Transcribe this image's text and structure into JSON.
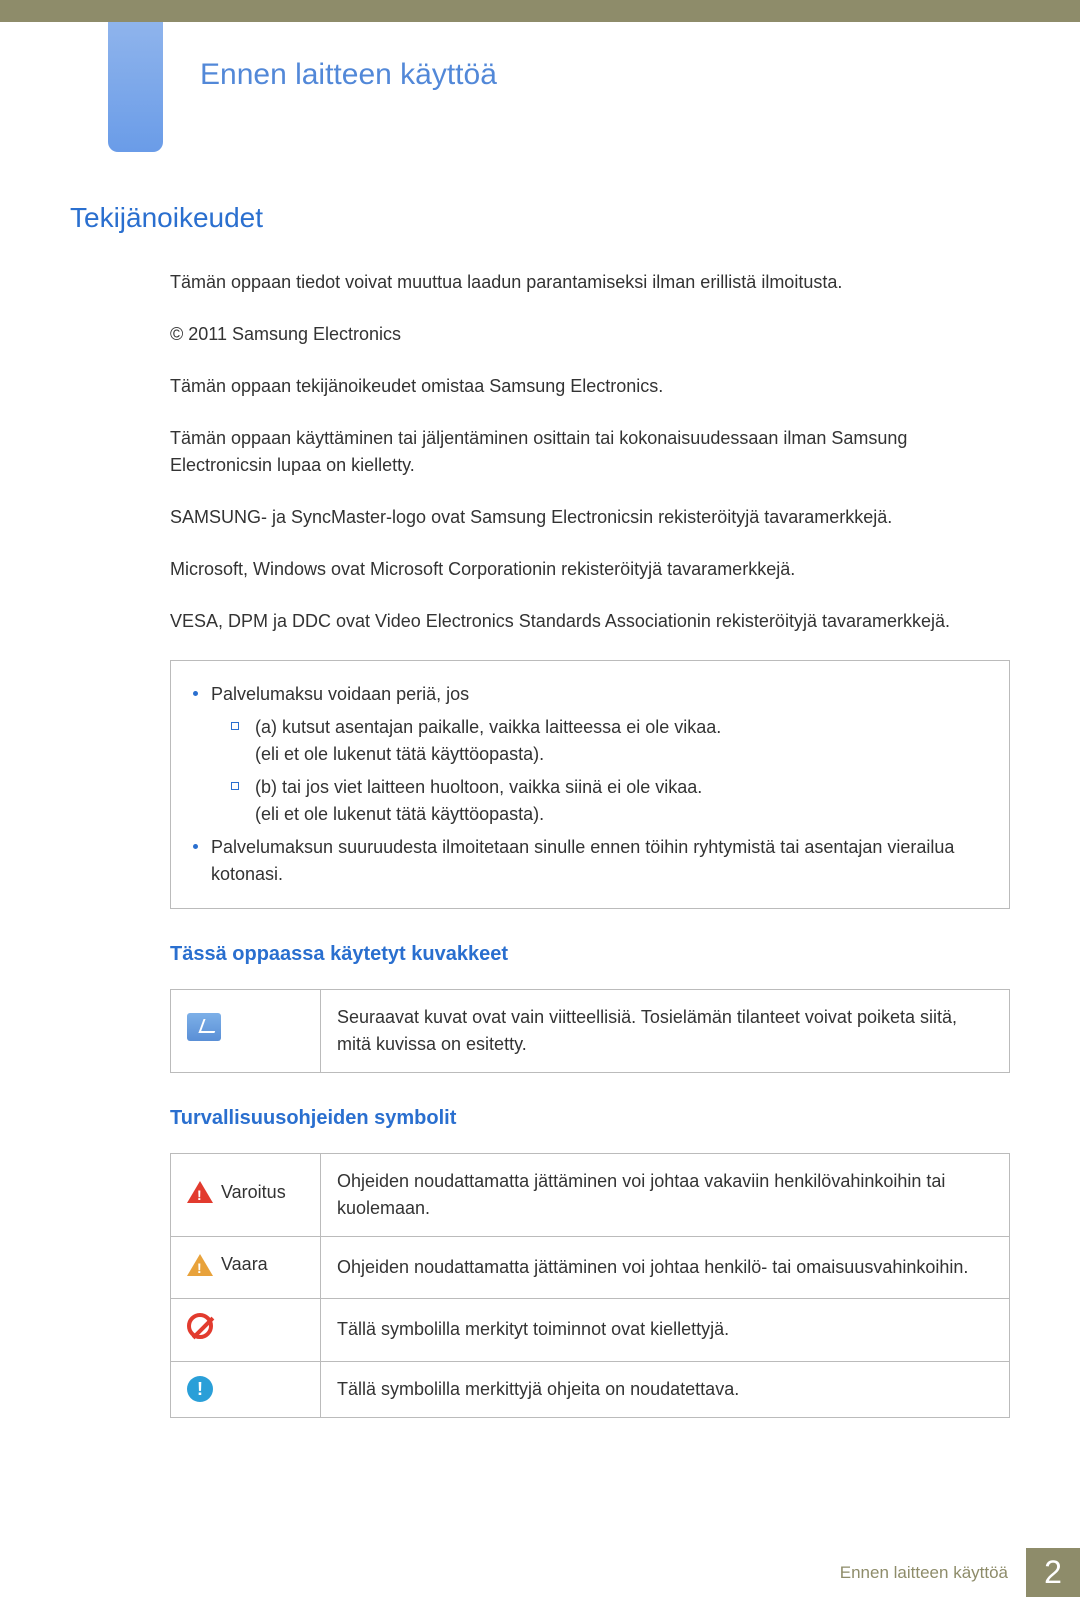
{
  "header": {
    "chapter_title": "Ennen laitteen käyttöä"
  },
  "section": {
    "title": "Tekijänoikeudet",
    "paragraphs": [
      "Tämän oppaan tiedot voivat muuttua laadun parantamiseksi ilman erillistä ilmoitusta.",
      "© 2011 Samsung Electronics",
      "Tämän oppaan tekijänoikeudet omistaa Samsung Electronics.",
      "Tämän oppaan käyttäminen tai jäljentäminen osittain tai kokonaisuudessaan ilman Samsung Electronicsin lupaa on kielletty.",
      "SAMSUNG- ja SyncMaster-logo ovat Samsung Electronicsin rekisteröityjä tavaramerkkejä.",
      "Microsoft, Windows ovat Microsoft Corporationin rekisteröityjä tavaramerkkejä.",
      "VESA, DPM ja DDC ovat Video Electronics Standards Associationin rekisteröityjä tavaramerkkejä."
    ],
    "fee_box": {
      "item1": "Palvelumaksu voidaan periä, jos",
      "sub_a": "(a) kutsut asentajan paikalle, vaikka laitteessa ei ole vikaa.",
      "sub_a_line2": "(eli et ole lukenut tätä käyttöopasta).",
      "sub_b": "(b) tai jos viet laitteen huoltoon, vaikka siinä ei ole vikaa.",
      "sub_b_line2": "(eli et ole lukenut tätä käyttöopasta).",
      "item2": "Palvelumaksun suuruudesta ilmoitetaan sinulle ennen töihin ryhtymistä tai asentajan vierailua kotonasi."
    },
    "icons_heading": "Tässä oppaassa käytetyt kuvakkeet",
    "icons_table": {
      "note_text": "Seuraavat kuvat ovat vain viitteellisiä. Tosielämän tilanteet voivat poiketa siitä, mitä kuvissa on esitetty."
    },
    "safety_heading": "Turvallisuusohjeiden symbolit",
    "safety_table": {
      "warning_label": "Varoitus",
      "warning_text": "Ohjeiden noudattamatta jättäminen voi johtaa vakaviin henkilövahinkoihin tai kuolemaan.",
      "caution_label": "Vaara",
      "caution_text": "Ohjeiden noudattamatta jättäminen voi johtaa henkilö- tai omaisuusvahinkoihin.",
      "prohibit_text": "Tällä symbolilla merkityt toiminnot ovat kiellettyjä.",
      "notice_text": "Tällä symbolilla merkittyjä ohjeita on noudatettava."
    }
  },
  "footer": {
    "label": "Ennen laitteen käyttöä",
    "page": "2"
  }
}
